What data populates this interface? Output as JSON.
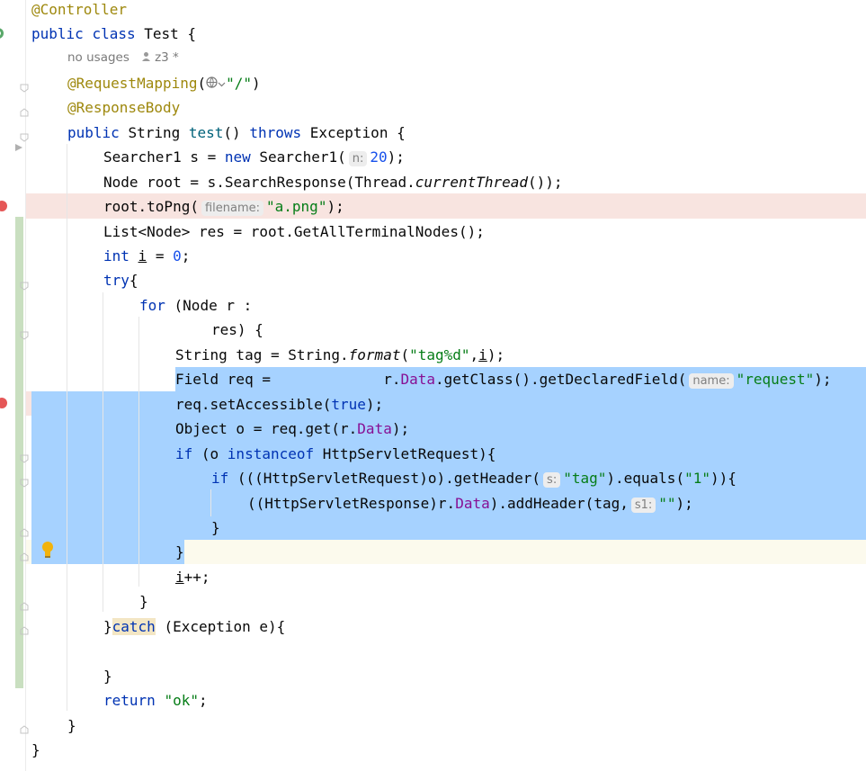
{
  "code": {
    "l0_controller": "@Controller",
    "l1_public": "public",
    "l1_class": "class",
    "l1_name": "Test {",
    "usages_label": "no usages",
    "usages_author": "z3 *",
    "l2_mapping": "@RequestMapping",
    "l2_open": "(",
    "l2_path": "\"/\"",
    "l2_close": ")",
    "l3_body": "@ResponseBody",
    "l4_public": "public",
    "l4_type": "String",
    "l4_method": "test",
    "l4_parens": "()",
    "l4_throws": "throws",
    "l4_exc": "Exception {",
    "l5_a": "Searcher1 s = ",
    "l5_new": "new",
    "l5_b": " Searcher1(",
    "l5_hint": "n:",
    "l5_num": "20",
    "l5_c": ");",
    "l6_a": "Node root = s.SearchResponse(Thread.",
    "l6_it": "currentThread",
    "l6_b": "());",
    "l7_a": "root.toPng(",
    "l7_hint": "filename:",
    "l7_str": "\"a.png\"",
    "l7_b": ");",
    "l8": "List<Node> res = root.GetAllTerminalNodes();",
    "l9_int": "int",
    "l9_var": "i",
    "l9_eq": " = ",
    "l9_num": "0",
    "l9_semi": ";",
    "l10_try": "try",
    "l10_b": "{",
    "l11_for": "for",
    "l11_b": " (Node r :",
    "l12": "res) {",
    "l13_a": "String tag = String.",
    "l13_it": "format",
    "l13_b": "(",
    "l13_str": "\"tag%d\"",
    "l13_c": ",",
    "l13_var": "i",
    "l13_d": ");",
    "l14_a": "Field req =             r.",
    "l14_fld": "Data",
    "l14_b": ".getClass().getDeclaredField(",
    "l14_hint": "name:",
    "l14_str": "\"request\"",
    "l14_c": ");",
    "l15_a": "req.setAccessible(",
    "l15_kw": "true",
    "l15_b": ");",
    "l16_a": "Object o = req.get(r.",
    "l16_fld": "Data",
    "l16_b": ");",
    "l17_if": "if",
    "l17_a": " (o ",
    "l17_inst": "instanceof",
    "l17_b": " HttpServletRequest){",
    "l18_if": "if",
    "l18_a": " (((HttpServletRequest)o).getHeader(",
    "l18_hint": "s:",
    "l18_str": "\"tag\"",
    "l18_b": ").equals(",
    "l18_str2": "\"1\"",
    "l18_c": ")){",
    "l19_a": "((HttpServletResponse)r.",
    "l19_fld": "Data",
    "l19_b": ").addHeader(tag,",
    "l19_hint": "s1:",
    "l19_str": "\"\"",
    "l19_c": ");",
    "l20": "}",
    "l21": "}",
    "l22_var": "i",
    "l22_b": "++;",
    "l23": "}",
    "l24_a": "}",
    "l24_catch": "catch",
    "l24_b": " (Exception e){",
    "l26": "}",
    "l27_ret": "return",
    "l27_sp": " ",
    "l27_str": "\"ok\"",
    "l27_b": ";",
    "l28": "}",
    "l29": "}"
  },
  "colors": {
    "keyword": "#0033b3",
    "annotation": "#9e880d",
    "string": "#067d17",
    "number": "#1750eb",
    "field": "#871094",
    "selection": "#a6d2ff",
    "breakpoint": "#e55757",
    "breakpoint_line": "#f8e4e0"
  },
  "icons": {
    "run_gutter": "run-class-icon",
    "globe": "globe-icon",
    "user": "user-icon",
    "bulb": "lightbulb-icon",
    "breakpoint": "breakpoint-icon"
  }
}
